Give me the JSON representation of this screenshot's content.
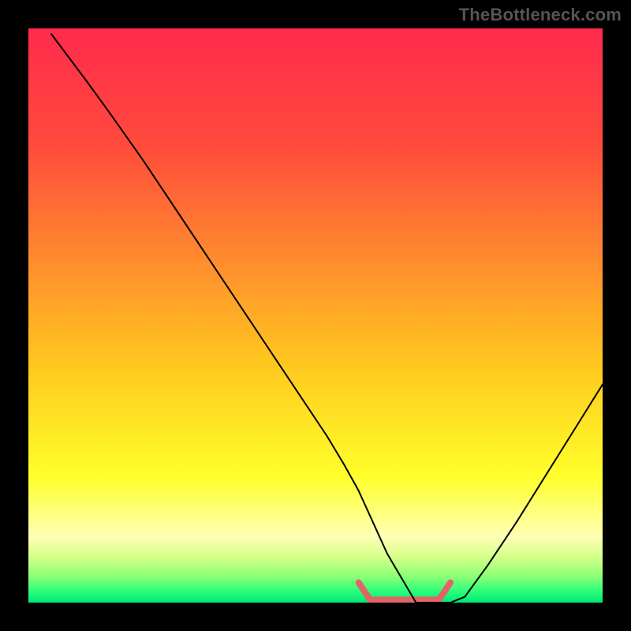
{
  "watermark": "TheBottleneck.com",
  "chart_data": {
    "type": "line",
    "title": "",
    "xlabel": "",
    "ylabel": "",
    "xlim": [
      0,
      100
    ],
    "ylim": [
      0,
      100
    ],
    "axes_visible": false,
    "background_gradient_stops": [
      {
        "offset": 0.0,
        "color": "#ff2a4c"
      },
      {
        "offset": 0.2,
        "color": "#ff4a3c"
      },
      {
        "offset": 0.4,
        "color": "#ff8a2e"
      },
      {
        "offset": 0.58,
        "color": "#ffc61f"
      },
      {
        "offset": 0.78,
        "color": "#ffff2a"
      },
      {
        "offset": 0.885,
        "color": "#ffffb5"
      },
      {
        "offset": 0.92,
        "color": "#d6ff8a"
      },
      {
        "offset": 0.955,
        "color": "#8aff76"
      },
      {
        "offset": 0.98,
        "color": "#2cff7a"
      },
      {
        "offset": 1.0,
        "color": "#00e676"
      }
    ],
    "series": [
      {
        "name": "bottleneck-curve",
        "stroke": "#000000",
        "stroke_width": 2,
        "x": [
          4.0,
          7.0,
          10.0,
          14.0,
          20.0,
          28.0,
          36.0,
          44.0,
          52.0,
          55.0,
          57.5,
          60.0,
          62.5,
          67.5,
          71.0,
          73.5,
          76.0,
          80.0,
          85.0,
          90.0,
          95.0,
          100.0
        ],
        "y": [
          99.0,
          95.0,
          91.0,
          85.5,
          77.0,
          65.0,
          53.0,
          41.0,
          29.0,
          24.0,
          19.5,
          14.0,
          8.5,
          0.0,
          0.0,
          0.0,
          1.0,
          6.5,
          14.0,
          22.0,
          30.0,
          38.0
        ]
      }
    ],
    "highlight": {
      "name": "highlight-band",
      "color": "#e06666",
      "stroke_width": 8,
      "x_start": 57.5,
      "x_end": 73.5,
      "y_start": 19.5,
      "y_bottom": 0.0,
      "y_end": 0.0
    }
  }
}
